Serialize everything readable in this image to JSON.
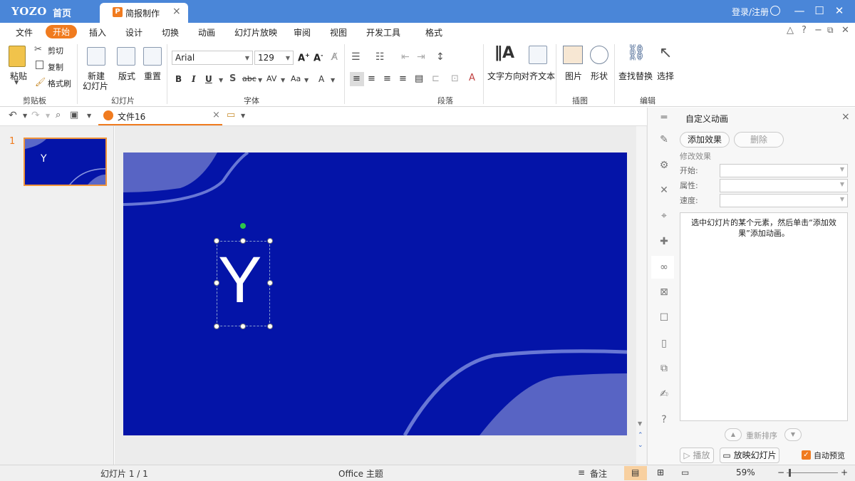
{
  "titlebar": {
    "logo": "YOZO",
    "home": "首页",
    "doc_tab": "简报制作",
    "doc_tab_icon": "P",
    "login": "登录/注册"
  },
  "menu": [
    "文件",
    "开始",
    "插入",
    "设计",
    "切换",
    "动画",
    "幻灯片放映",
    "审阅",
    "视图",
    "开发工具",
    "格式"
  ],
  "menu_active": "开始",
  "clipboard": {
    "paste": "粘贴",
    "cut": "剪切",
    "copy": "复制",
    "painter": "格式刷",
    "group": "剪贴板"
  },
  "slides_group": {
    "new": "新建",
    "new2": "幻灯片",
    "layout": "版式",
    "reset": "重置",
    "group": "幻灯片"
  },
  "font": {
    "name": "Arial",
    "size": "129",
    "group": "字体",
    "bold": "B",
    "italic": "I",
    "underline": "U",
    "strike": "abc",
    "spacing": "AV",
    "case": "Aa",
    "color": "A"
  },
  "paragraph": {
    "group": "段落"
  },
  "text_dir": {
    "dir": "文字方向",
    "align": "对齐文本"
  },
  "insert": {
    "picture": "图片",
    "shape": "形状",
    "group": "插图"
  },
  "edit": {
    "find": "查找替换",
    "select": "选择",
    "group": "编辑"
  },
  "file_tab": "文件16",
  "thumb": {
    "number": "1",
    "text": "Y"
  },
  "slide": {
    "text": "Y"
  },
  "anim_panel": {
    "title": "自定义动画",
    "add": "添加效果",
    "delete": "删除",
    "modify": "修改效果",
    "start": "开始:",
    "property": "属性:",
    "speed": "速度:",
    "hint": "选中幻灯片的某个元素，然后单击“添加效果”添加动画。",
    "reorder": "重新排序",
    "play": "播放",
    "show": "放映幻灯片",
    "autopreview": "自动预览"
  },
  "status": {
    "slide": "幻灯片 1 / 1",
    "theme": "Office 主题",
    "notes": "备注",
    "zoom": "59%"
  },
  "colors": {
    "accent": "#f07b1f",
    "titlebar": "#4a86d8",
    "slide_bg": "#0414a8"
  }
}
